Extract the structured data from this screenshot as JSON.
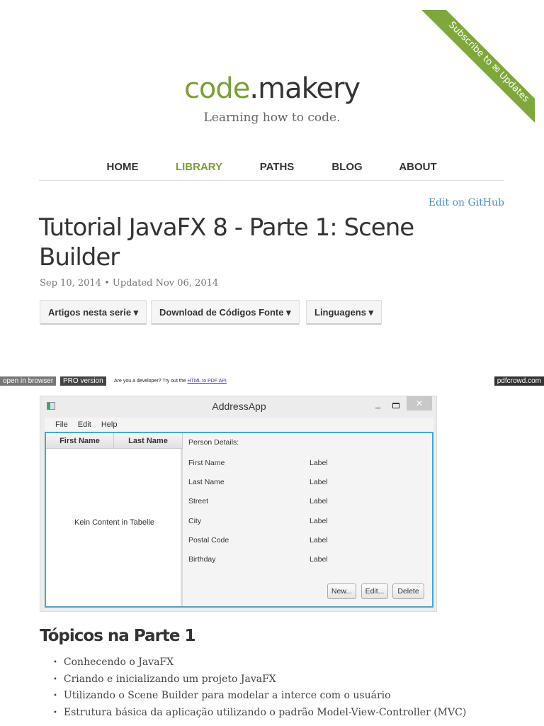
{
  "ribbon": {
    "text": "Subscribe to ✉ Updates"
  },
  "logo": {
    "part1": "code",
    "part2": ".makery"
  },
  "tagline": "Learning how to code.",
  "nav": [
    {
      "label": "HOME"
    },
    {
      "label": "LIBRARY"
    },
    {
      "label": "PATHS"
    },
    {
      "label": "BLOG"
    },
    {
      "label": "ABOUT"
    }
  ],
  "edit_link": "Edit on GitHub",
  "title": "Tutorial JavaFX 8 - Parte 1: Scene Builder",
  "date": "Sep 10, 2014 • Updated Nov 06, 2014",
  "buttons": [
    "Artigos nesta serie ▾",
    "Download de Códigos Fonte ▾",
    "Linguagens ▾"
  ],
  "pdfcrowd": {
    "open": "open in browser",
    "pro": "PRO version",
    "dev_text": "Are you a developer? Try out the ",
    "dev_link": "HTML to PDF API",
    "brand": "pdfcrowd.com"
  },
  "app": {
    "title": "AddressApp",
    "min": "–",
    "close": "✕",
    "menu": [
      "File",
      "Edit",
      "Help"
    ],
    "columns": [
      "First Name",
      "Last Name"
    ],
    "empty": "Kein Content in Tabelle",
    "details_title": "Person Details:",
    "fields": [
      {
        "name": "First Name",
        "value": "Label"
      },
      {
        "name": "Last Name",
        "value": "Label"
      },
      {
        "name": "Street",
        "value": "Label"
      },
      {
        "name": "City",
        "value": "Label"
      },
      {
        "name": "Postal Code",
        "value": "Label"
      },
      {
        "name": "Birthday",
        "value": "Label"
      }
    ],
    "actions": [
      "New...",
      "Edit...",
      "Delete"
    ]
  },
  "section": {
    "heading": "Tópicos na Parte 1",
    "items": [
      "Conhecendo o JavaFX",
      "Criando e inicializando um projeto JavaFX",
      "Utilizando o Scene Builder para modelar a interce com o usuário",
      "Estrutura básica da aplicação utilizando o padrão Model-View-Controller (MVC)"
    ]
  }
}
